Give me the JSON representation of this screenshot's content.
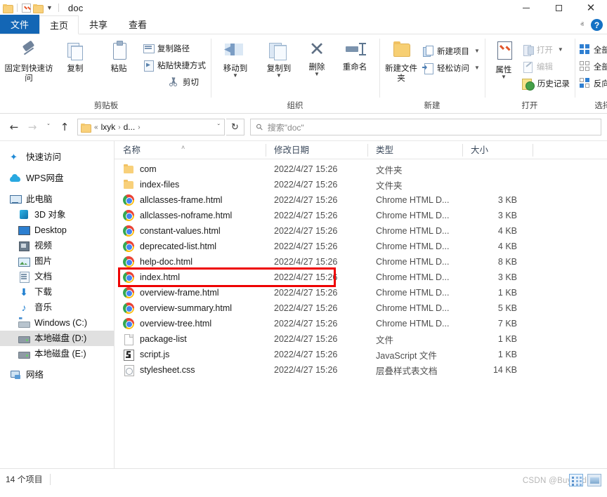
{
  "window": {
    "title": "doc",
    "quick_access": [
      "folder-icon",
      "checkbox-icon",
      "folder-icon",
      "dropdown-caret"
    ],
    "minimize_label": "",
    "maximize_label": "",
    "close_label": "✕"
  },
  "ribbon": {
    "tabs": [
      {
        "label": "文件",
        "kind": "file"
      },
      {
        "label": "主页",
        "kind": "active"
      },
      {
        "label": "共享",
        "kind": "normal"
      },
      {
        "label": "查看",
        "kind": "normal"
      }
    ],
    "help_label": "?",
    "collapse_label": "ⱏ",
    "groups": [
      {
        "name": "clipboard",
        "label": "剪贴板",
        "big_buttons": [
          {
            "label": "固定到快速访问",
            "icon": "pin-icon"
          },
          {
            "label": "复制",
            "icon": "copy-icon"
          },
          {
            "label": "粘贴",
            "icon": "paste-icon"
          }
        ],
        "small_buttons": [
          {
            "label": "复制路径",
            "icon": "copy-path-icon"
          },
          {
            "label": "粘贴快捷方式",
            "icon": "paste-shortcut-icon"
          },
          {
            "label": "剪切",
            "icon": "scissors-icon"
          }
        ]
      },
      {
        "name": "organize",
        "label": "组织",
        "big_buttons": [
          {
            "label": "移动到",
            "icon": "move-to-icon",
            "caret": true
          },
          {
            "label": "复制到",
            "icon": "copy-to-icon",
            "caret": true
          },
          {
            "label": "删除",
            "icon": "delete-icon",
            "caret": true
          },
          {
            "label": "重命名",
            "icon": "rename-icon"
          }
        ]
      },
      {
        "name": "new",
        "label": "新建",
        "big_buttons": [
          {
            "label": "新建文件夹",
            "icon": "new-folder-icon"
          }
        ],
        "small_buttons": [
          {
            "label": "新建项目",
            "icon": "new-item-icon",
            "caret": true
          },
          {
            "label": "轻松访问",
            "icon": "easy-access-icon",
            "caret": true
          }
        ]
      },
      {
        "name": "open",
        "label": "打开",
        "big_buttons": [
          {
            "label": "属性",
            "icon": "properties-icon",
            "caret": true
          }
        ],
        "small_buttons": [
          {
            "label": "打开",
            "icon": "open-icon",
            "caret": true,
            "dim": true
          },
          {
            "label": "编辑",
            "icon": "edit-icon",
            "dim": true
          },
          {
            "label": "历史记录",
            "icon": "history-icon"
          }
        ]
      },
      {
        "name": "select",
        "label": "选择",
        "small_buttons": [
          {
            "label": "全部选择",
            "icon": "select-all-icon"
          },
          {
            "label": "全部取消",
            "icon": "select-none-icon"
          },
          {
            "label": "反向选择",
            "icon": "invert-selection-icon"
          }
        ]
      }
    ]
  },
  "addressbar": {
    "back_label": "←",
    "forward_label": "→",
    "recent_label": "ˇ",
    "up_label": "↑",
    "breadcrumbs": [
      "«",
      "lxyk",
      "›",
      "d...",
      "›"
    ],
    "dropdown_label": "ˇ",
    "refresh_label": "↻",
    "search_placeholder": "搜索\"doc\"",
    "search_value": ""
  },
  "navpane": {
    "items": [
      {
        "label": "快速访问",
        "icon": "star-icon",
        "indent": false,
        "selected": false
      },
      {
        "label": "WPS网盘",
        "icon": "cloud-icon",
        "indent": false,
        "selected": false
      },
      {
        "label": "此电脑",
        "icon": "this-pc-icon",
        "indent": false,
        "selected": false
      },
      {
        "label": "3D 对象",
        "icon": "3d-objects-icon",
        "indent": true,
        "selected": false
      },
      {
        "label": "Desktop",
        "icon": "desktop-icon",
        "indent": true,
        "selected": false
      },
      {
        "label": "视频",
        "icon": "videos-icon",
        "indent": true,
        "selected": false
      },
      {
        "label": "图片",
        "icon": "pictures-icon",
        "indent": true,
        "selected": false
      },
      {
        "label": "文档",
        "icon": "documents-icon",
        "indent": true,
        "selected": false
      },
      {
        "label": "下载",
        "icon": "downloads-icon",
        "indent": true,
        "selected": false
      },
      {
        "label": "音乐",
        "icon": "music-icon",
        "indent": true,
        "selected": false
      },
      {
        "label": "Windows (C:)",
        "icon": "windows-drive-icon",
        "indent": true,
        "selected": false
      },
      {
        "label": "本地磁盘 (D:)",
        "icon": "drive-icon",
        "indent": true,
        "selected": true
      },
      {
        "label": "本地磁盘 (E:)",
        "icon": "drive-icon",
        "indent": true,
        "selected": false
      },
      {
        "label": "网络",
        "icon": "network-icon",
        "indent": false,
        "selected": false
      }
    ]
  },
  "filelist": {
    "columns": [
      "名称",
      "修改日期",
      "类型",
      "大小"
    ],
    "sort_indicator": "˄",
    "rows": [
      {
        "name": "com",
        "date": "2022/4/27 15:26",
        "type": "文件夹",
        "size": "",
        "icon": "folder-icon",
        "highlighted": false
      },
      {
        "name": "index-files",
        "date": "2022/4/27 15:26",
        "type": "文件夹",
        "size": "",
        "icon": "folder-icon",
        "highlighted": false
      },
      {
        "name": "allclasses-frame.html",
        "date": "2022/4/27 15:26",
        "type": "Chrome HTML D...",
        "size": "3 KB",
        "icon": "chrome-icon",
        "highlighted": false
      },
      {
        "name": "allclasses-noframe.html",
        "date": "2022/4/27 15:26",
        "type": "Chrome HTML D...",
        "size": "3 KB",
        "icon": "chrome-icon",
        "highlighted": false
      },
      {
        "name": "constant-values.html",
        "date": "2022/4/27 15:26",
        "type": "Chrome HTML D...",
        "size": "4 KB",
        "icon": "chrome-icon",
        "highlighted": false
      },
      {
        "name": "deprecated-list.html",
        "date": "2022/4/27 15:26",
        "type": "Chrome HTML D...",
        "size": "4 KB",
        "icon": "chrome-icon",
        "highlighted": false
      },
      {
        "name": "help-doc.html",
        "date": "2022/4/27 15:26",
        "type": "Chrome HTML D...",
        "size": "8 KB",
        "icon": "chrome-icon",
        "highlighted": false
      },
      {
        "name": "index.html",
        "date": "2022/4/27 15:26",
        "type": "Chrome HTML D...",
        "size": "3 KB",
        "icon": "chrome-icon",
        "highlighted": true
      },
      {
        "name": "overview-frame.html",
        "date": "2022/4/27 15:26",
        "type": "Chrome HTML D...",
        "size": "1 KB",
        "icon": "chrome-icon",
        "highlighted": false
      },
      {
        "name": "overview-summary.html",
        "date": "2022/4/27 15:26",
        "type": "Chrome HTML D...",
        "size": "5 KB",
        "icon": "chrome-icon",
        "highlighted": false
      },
      {
        "name": "overview-tree.html",
        "date": "2022/4/27 15:26",
        "type": "Chrome HTML D...",
        "size": "7 KB",
        "icon": "chrome-icon",
        "highlighted": false
      },
      {
        "name": "package-list",
        "date": "2022/4/27 15:26",
        "type": "文件",
        "size": "1 KB",
        "icon": "file-icon",
        "highlighted": false
      },
      {
        "name": "script.js",
        "date": "2022/4/27 15:26",
        "type": "JavaScript 文件",
        "size": "1 KB",
        "icon": "js-icon",
        "highlighted": false
      },
      {
        "name": "stylesheet.css",
        "date": "2022/4/27 15:26",
        "type": "层叠样式表文档",
        "size": "14 KB",
        "icon": "css-icon",
        "highlighted": false
      }
    ]
  },
  "statusbar": {
    "item_count": "14 个项目",
    "watermark": "CSDN @BuyAudi"
  },
  "colors": {
    "accent": "#1366b5",
    "highlight_box": "#ee0000",
    "selection": "#e0e0e0"
  }
}
